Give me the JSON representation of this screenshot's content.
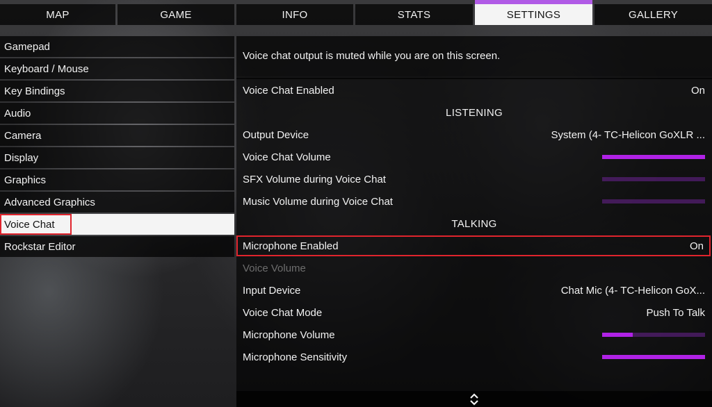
{
  "tabs": [
    {
      "label": "MAP"
    },
    {
      "label": "GAME"
    },
    {
      "label": "INFO"
    },
    {
      "label": "STATS"
    },
    {
      "label": "SETTINGS",
      "active": true
    },
    {
      "label": "GALLERY"
    }
  ],
  "sidebar": {
    "items": [
      {
        "label": "Gamepad"
      },
      {
        "label": "Keyboard / Mouse"
      },
      {
        "label": "Key Bindings"
      },
      {
        "label": "Audio"
      },
      {
        "label": "Camera"
      },
      {
        "label": "Display"
      },
      {
        "label": "Graphics"
      },
      {
        "label": "Advanced Graphics"
      },
      {
        "label": "Voice Chat",
        "active": true
      },
      {
        "label": "Rockstar Editor"
      }
    ]
  },
  "notice": "Voice chat output is muted while you are on this screen.",
  "settings": {
    "voice_chat_enabled": {
      "label": "Voice Chat Enabled",
      "value": "On"
    },
    "listening_header": "LISTENING",
    "output_device": {
      "label": "Output Device",
      "value": "System (4- TC-Helicon GoXLR ..."
    },
    "voice_chat_volume": {
      "label": "Voice Chat Volume",
      "level": 1.0
    },
    "sfx_volume": {
      "label": "SFX Volume during Voice Chat",
      "level": 0.0
    },
    "music_volume": {
      "label": "Music Volume during Voice Chat",
      "level": 0.0
    },
    "talking_header": "TALKING",
    "microphone_enabled": {
      "label": "Microphone Enabled",
      "value": "On"
    },
    "voice_volume": {
      "label": "Voice Volume"
    },
    "input_device": {
      "label": "Input Device",
      "value": "Chat Mic (4- TC-Helicon GoX..."
    },
    "voice_chat_mode": {
      "label": "Voice Chat Mode",
      "value": "Push To Talk"
    },
    "microphone_volume": {
      "label": "Microphone Volume",
      "level": 0.3
    },
    "microphone_sensitivity": {
      "label": "Microphone Sensitivity",
      "level": 1.0
    }
  },
  "colors": {
    "accent": "#b15be6",
    "slider_fill": "#b022e6",
    "highlight_border": "#e0242d"
  },
  "icons": {
    "scroll": "up-down-chevron-icon"
  }
}
